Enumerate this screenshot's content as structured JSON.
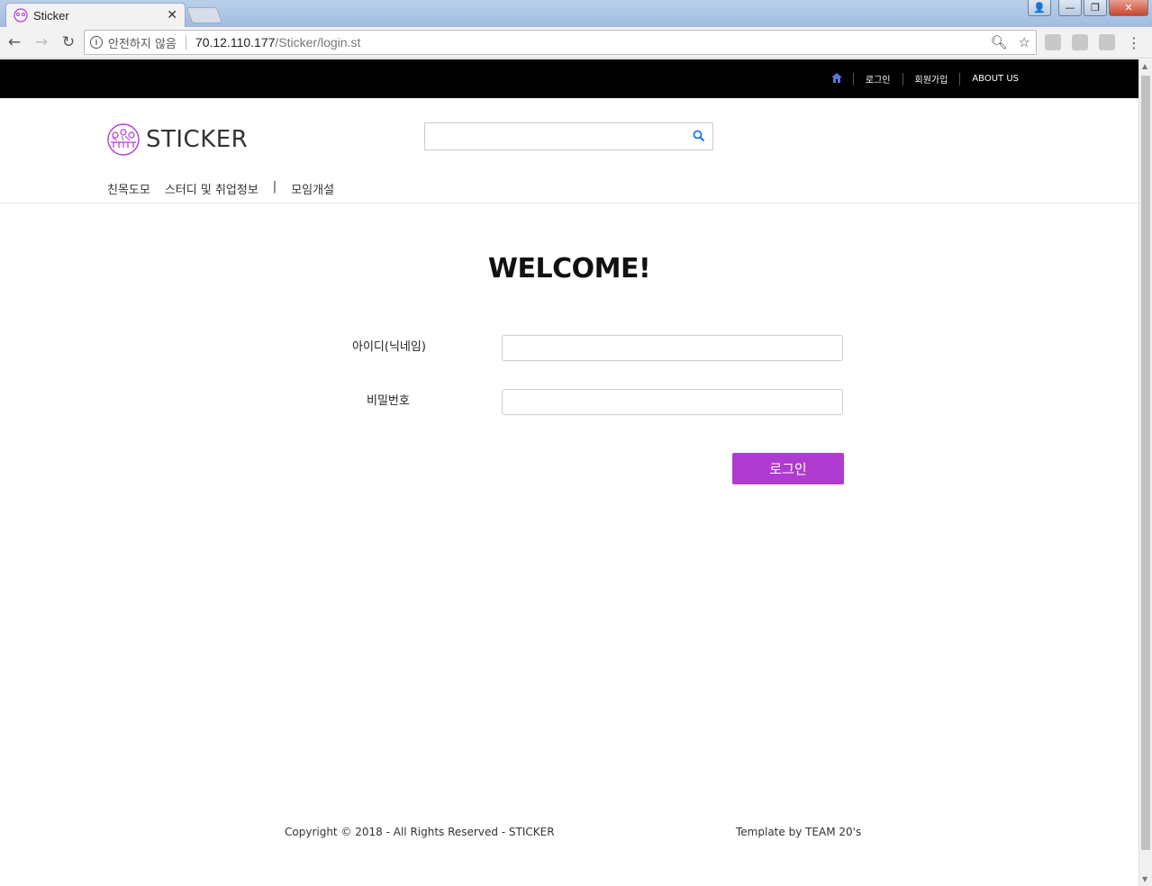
{
  "browser": {
    "tab_title": "Sticker",
    "tab_close": "✕",
    "window_controls": {
      "minimize": "—",
      "restore": "❐",
      "close": "✕"
    },
    "address": {
      "security_label": "안전하지 않음",
      "url_host": "70.12.110.177",
      "url_path": "/Sticker/login.st"
    },
    "icons": {
      "back": "back-icon",
      "forward": "forward-icon",
      "reload": "reload-icon",
      "zoom": "zoom-icon",
      "bookmark": "star-icon"
    }
  },
  "topnav": {
    "home_icon": "home-icon",
    "items": [
      "로그인",
      "회원가입",
      "ABOUT US"
    ]
  },
  "header": {
    "logo_text": "STICKER",
    "search_placeholder": "",
    "menu": [
      "친목도모",
      "스터디 및 취업정보",
      "|",
      "모임개설"
    ]
  },
  "login": {
    "title": "WELCOME!",
    "id_label": "아이디(닉네임)",
    "id_value": "",
    "password_label": "비밀번호",
    "password_value": "",
    "submit_label": "로그인"
  },
  "footer": {
    "copyright": "Copyright © 2018 - All Rights Reserved - STICKER",
    "template": "Template by TEAM 20's"
  },
  "colors": {
    "accent": "#b03bd0",
    "topbar": "#000000",
    "home_icon": "#5a73d9"
  }
}
